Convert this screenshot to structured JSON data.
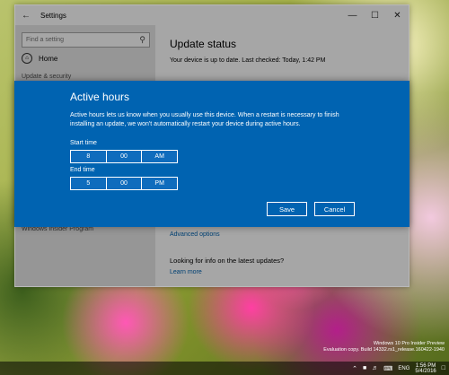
{
  "window": {
    "title": "Settings",
    "back_glyph": "←",
    "controls": {
      "minimize": "—",
      "maximize": "☐",
      "close": "✕"
    }
  },
  "sidebar": {
    "search_placeholder": "Find a setting",
    "home_label": "Home",
    "section_label": "Update & security",
    "insider_label": "Windows Insider Program"
  },
  "main": {
    "title": "Update status",
    "status_text": "Your device is up to date. Last checked: Today, 1:42 PM",
    "advanced_options": "Advanced options",
    "looking_info": "Looking for info on the latest updates?",
    "learn_more": "Learn more"
  },
  "dialog": {
    "title": "Active hours",
    "description": "Active hours lets us know when you usually use this device. When a restart is necessary to finish installing an update, we won't automatically restart your device during active hours.",
    "start_label": "Start time",
    "start": {
      "hour": "8",
      "minute": "00",
      "period": "AM"
    },
    "end_label": "End time",
    "end": {
      "hour": "5",
      "minute": "00",
      "period": "PM"
    },
    "save_label": "Save",
    "cancel_label": "Cancel"
  },
  "desktop": {
    "watermark_line1": "Windows 10 Pro Insider Preview",
    "watermark_line2": "Evaluation copy. Build 14332.rs1_release.160422-1940"
  },
  "taskbar": {
    "language": "ENG",
    "time": "1:56 PM",
    "date": "5/4/2016"
  },
  "colors": {
    "dialog_blue": "#0063b1",
    "link_blue": "#0063b1"
  }
}
